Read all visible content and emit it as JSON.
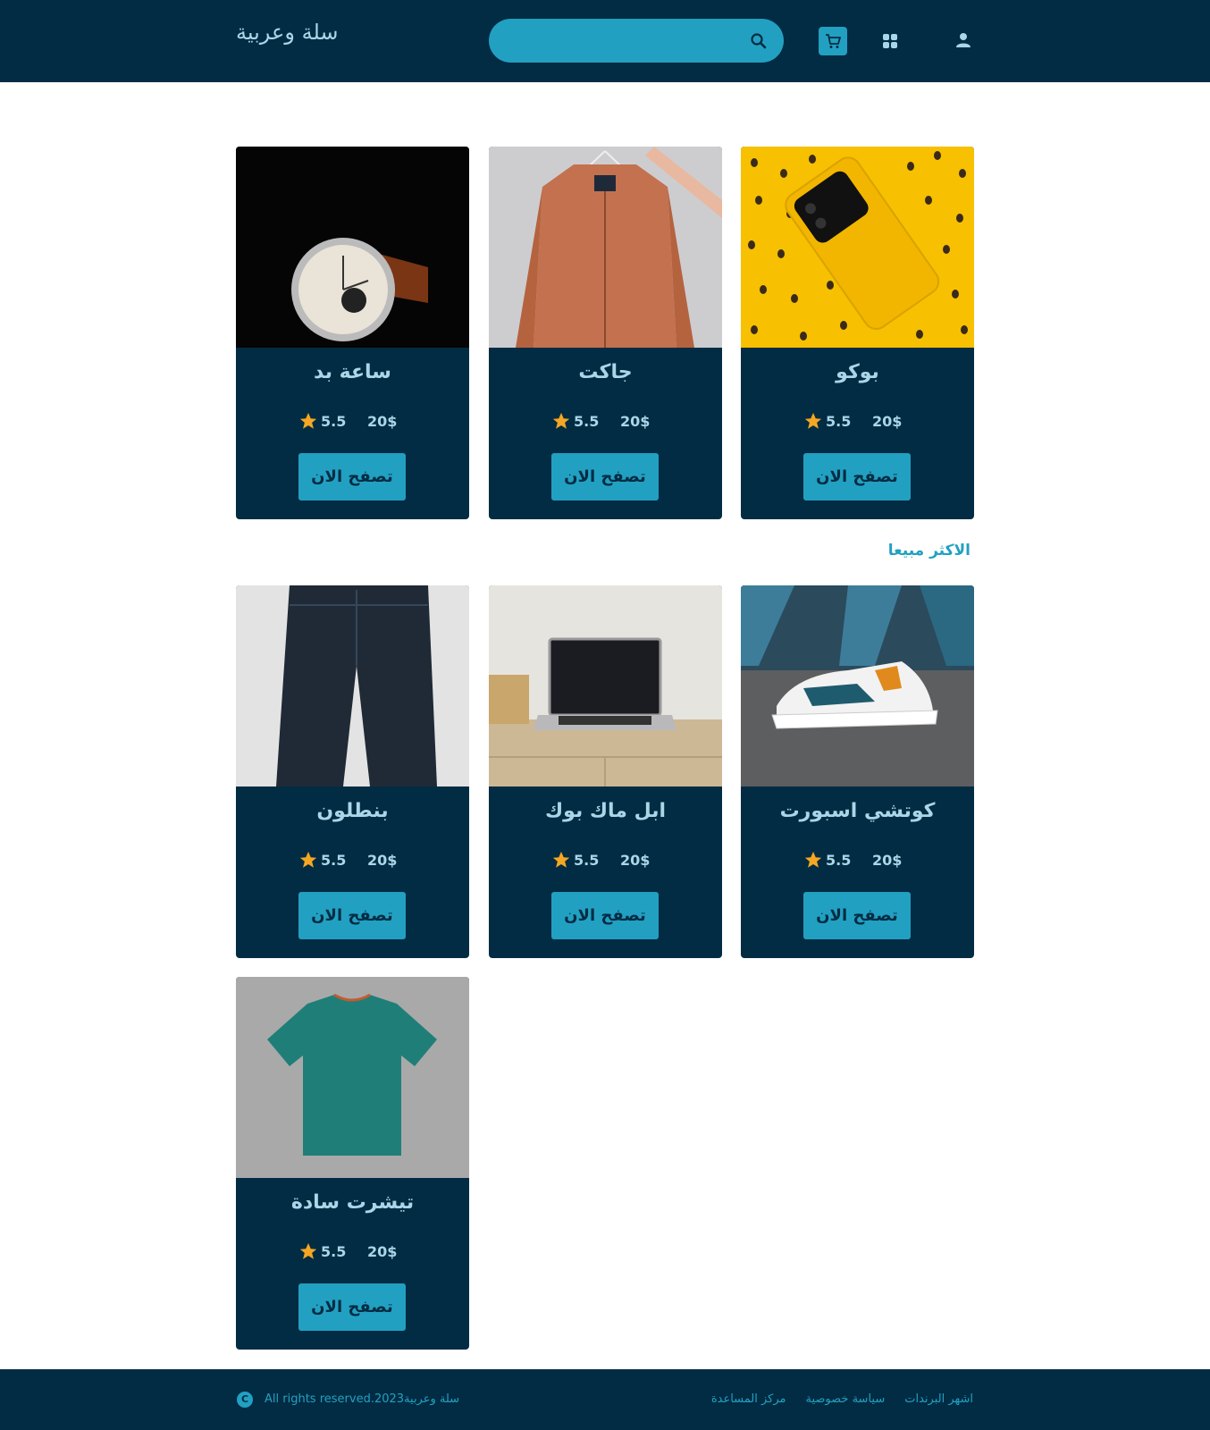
{
  "header": {
    "logo": "سلة وعربية",
    "search_placeholder": ""
  },
  "product_card": {
    "rating": "5.5",
    "price": "20$",
    "browse_label": "تصفح الان"
  },
  "featured": [
    {
      "name": "بوكو",
      "image": "yellow-poco-phone-on-coffee-beans"
    },
    {
      "name": "جاكت",
      "image": "orange-jacket-on-hanger"
    },
    {
      "name": "ساعة بد",
      "image": "wrist-watch-black-background"
    }
  ],
  "best_sellers": {
    "title": "الاكثر مبيعا",
    "items": [
      {
        "name": "كوتشي اسبورت",
        "image": "sneaker-on-asphalt"
      },
      {
        "name": "ابل ماك بوك",
        "image": "laptop-on-desk"
      },
      {
        "name": "بنطلون",
        "image": "dark-jeans"
      },
      {
        "name": "تيشرت سادة",
        "image": "teal-tshirt"
      }
    ]
  },
  "footer": {
    "copyright": "All rights reserved.سلة وعربية2023",
    "links": [
      "اشهر البرندات",
      "سياسة خصوصية",
      "مركز المساعدة"
    ]
  },
  "colors": {
    "navy": "#022c43",
    "accent": "#22a0c2",
    "light": "#a9d6e8",
    "star": "#f5a623"
  }
}
